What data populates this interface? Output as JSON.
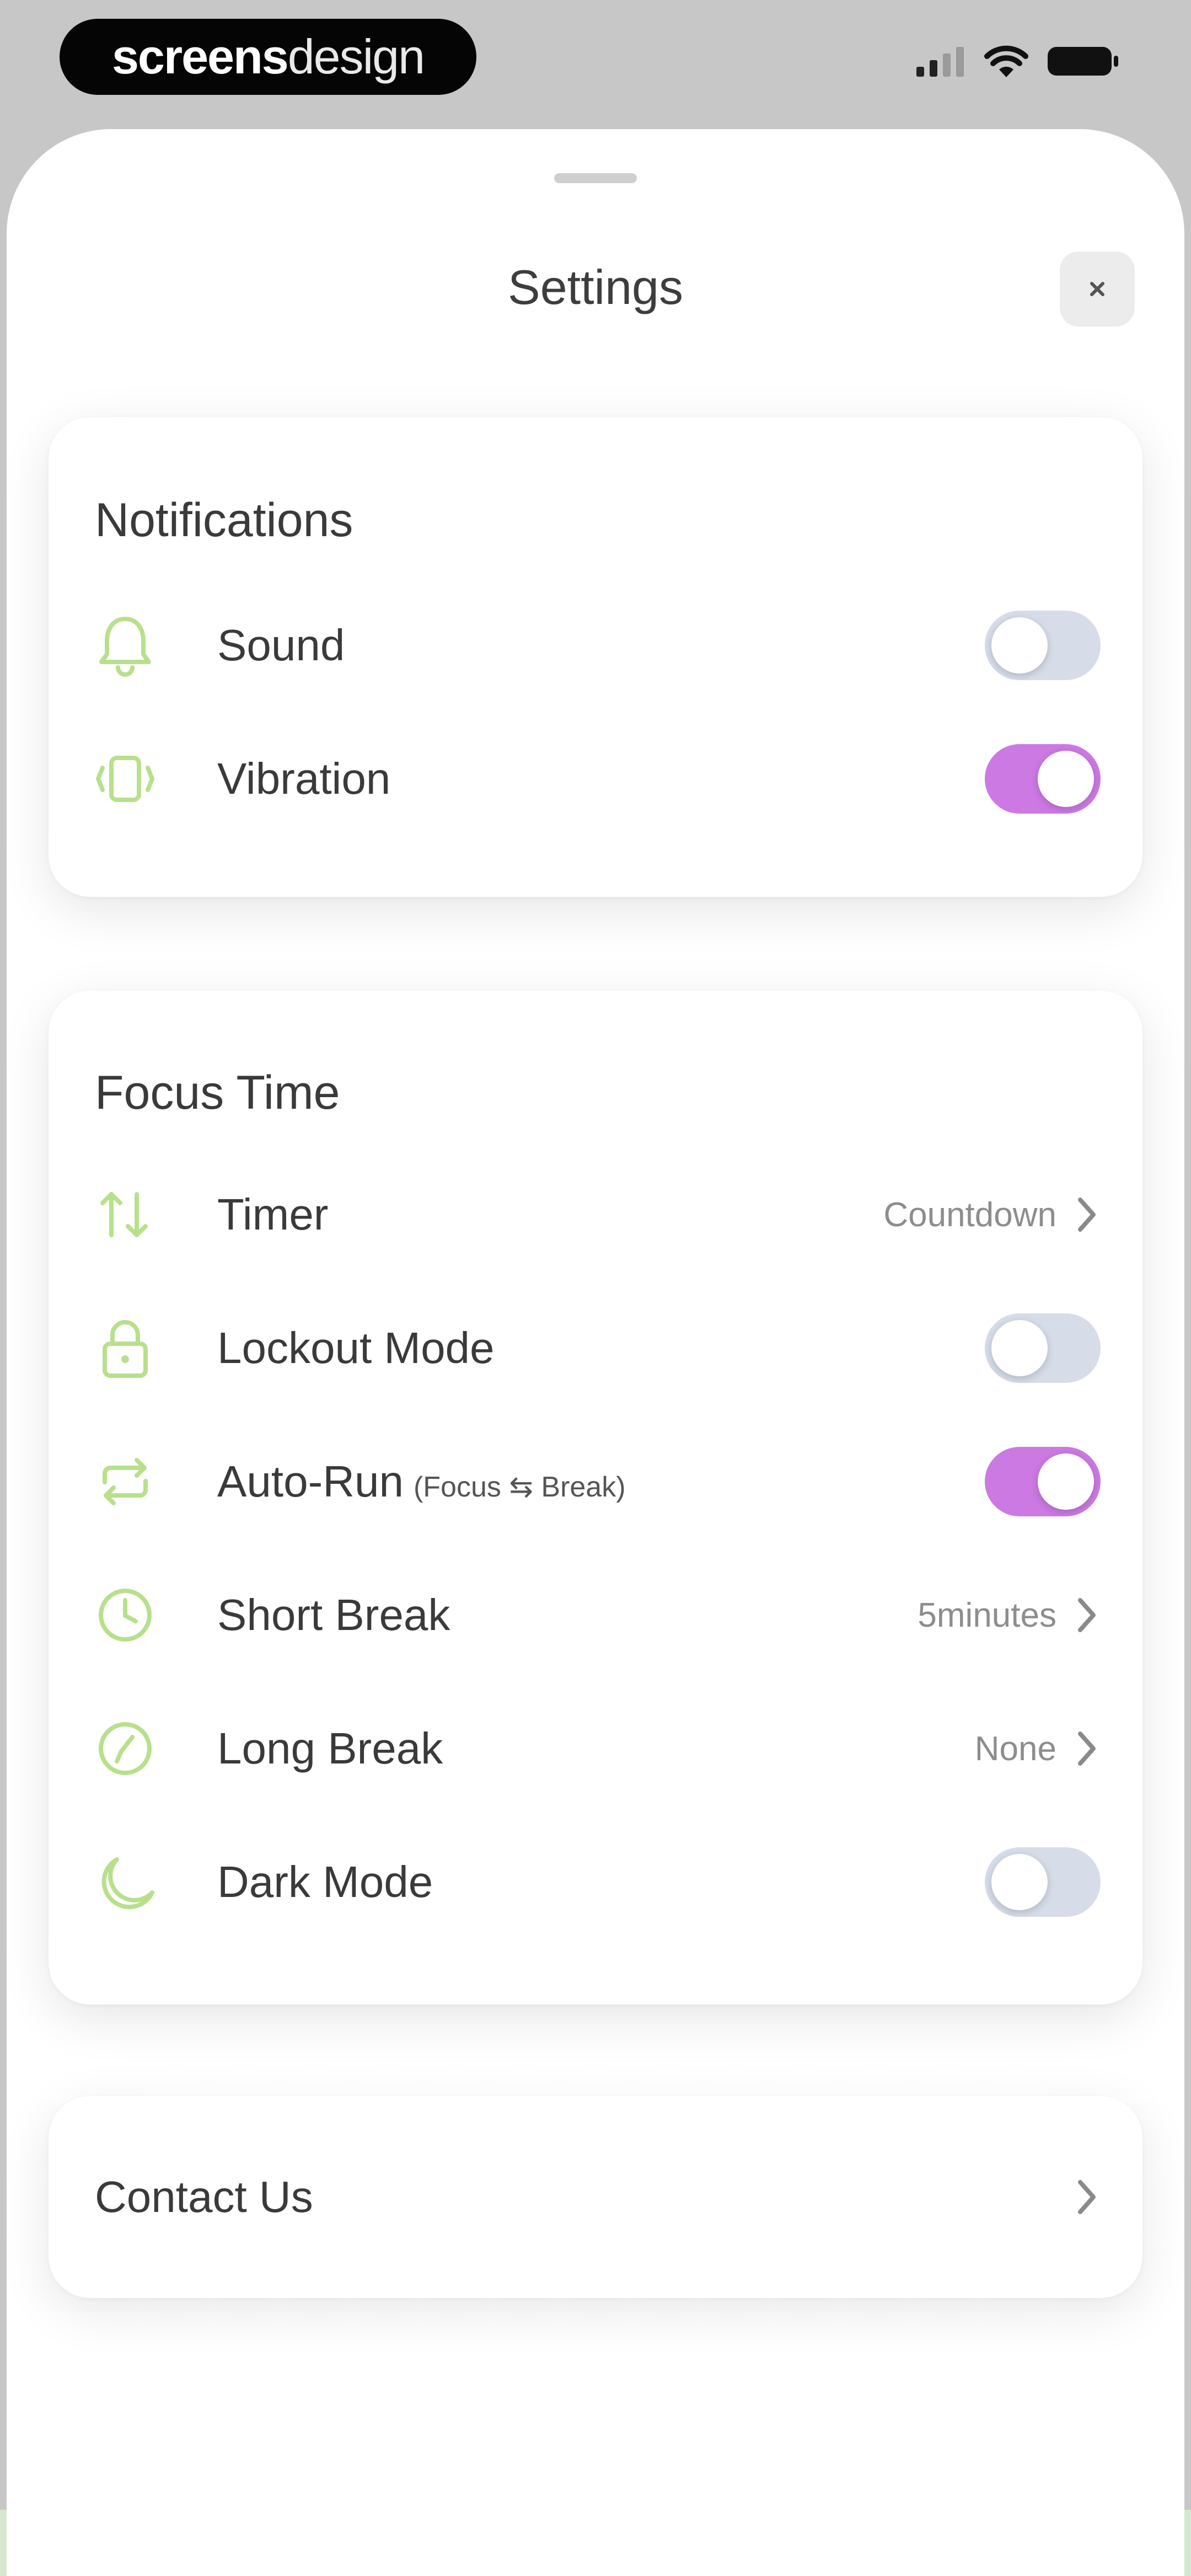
{
  "status_bar": {
    "brand_bold": "screens",
    "brand_light": "design"
  },
  "sheet": {
    "title": "Settings",
    "close_glyph": "×"
  },
  "notifications": {
    "title": "Notifications",
    "items": [
      {
        "label": "Sound",
        "icon": "bell-icon",
        "toggle": false
      },
      {
        "label": "Vibration",
        "icon": "vibration-icon",
        "toggle": true
      }
    ]
  },
  "focus_time": {
    "title": "Focus Time",
    "items": [
      {
        "label": "Timer",
        "icon": "swap-arrows-icon",
        "value": "Countdown"
      },
      {
        "label": "Lockout Mode",
        "icon": "lock-icon",
        "toggle": false
      },
      {
        "label": "Auto-Run",
        "sublabel": "(Focus ⇆ Break)",
        "icon": "repeat-icon",
        "toggle": true
      },
      {
        "label": "Short Break",
        "icon": "clock-icon",
        "value": "5minutes"
      },
      {
        "label": "Long Break",
        "icon": "compass-icon",
        "value": "None"
      },
      {
        "label": "Dark Mode",
        "icon": "moon-icon",
        "toggle": false
      }
    ]
  },
  "contact": {
    "label": "Contact Us"
  },
  "colors": {
    "accent_icon": "#b8e08c",
    "toggle_on": "#cc79e3",
    "toggle_off": "#d6dde8"
  }
}
